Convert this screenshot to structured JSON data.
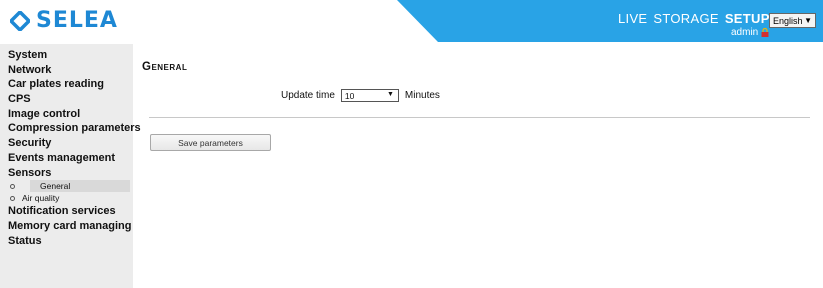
{
  "header": {
    "logo_text": "SELEA",
    "nav": [
      {
        "label": "Live",
        "active": false
      },
      {
        "label": "Storage",
        "active": false
      },
      {
        "label": "Setup",
        "active": true
      }
    ],
    "language": {
      "selected": "English"
    },
    "user": {
      "name": "admin",
      "icon": "lock-icon"
    },
    "accent_color": "#1e88d4",
    "band_color": "#29a3e6"
  },
  "sidebar": {
    "items": [
      {
        "label": "System"
      },
      {
        "label": "Network"
      },
      {
        "label": "Car plates reading"
      },
      {
        "label": "CPS"
      },
      {
        "label": "Image control"
      },
      {
        "label": "Compression parameters"
      },
      {
        "label": "Security"
      },
      {
        "label": "Events management"
      },
      {
        "label": "Sensors"
      },
      {
        "label": "Notification services"
      },
      {
        "label": "Memory card managing"
      },
      {
        "label": "Status"
      }
    ],
    "sensors_sub": [
      {
        "label": "General",
        "active": true
      },
      {
        "label": "Air quality",
        "active": false
      }
    ]
  },
  "main": {
    "title": "General",
    "update_time": {
      "label": "Update time",
      "value": "10",
      "unit": "Minutes"
    },
    "save_label": "Save parameters"
  }
}
